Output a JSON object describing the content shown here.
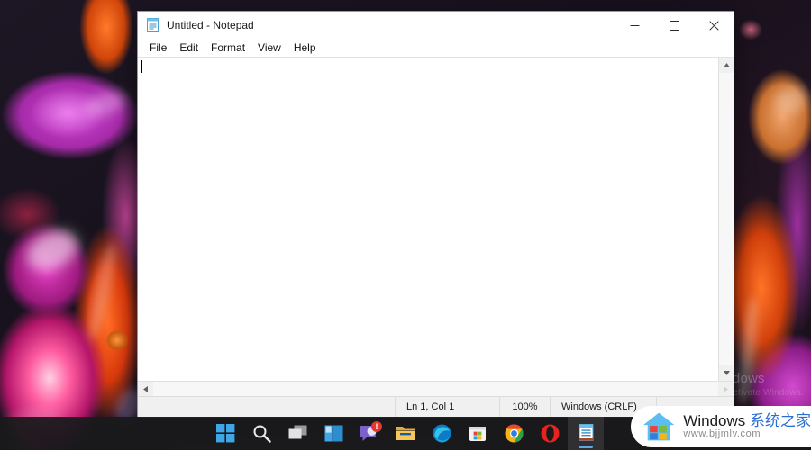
{
  "window": {
    "title": "Untitled - Notepad",
    "icon": "notepad-icon",
    "controls": {
      "minimize": "Minimize",
      "maximize": "Maximize",
      "close": "Close"
    }
  },
  "menubar": {
    "items": [
      {
        "label": "File"
      },
      {
        "label": "Edit"
      },
      {
        "label": "Format"
      },
      {
        "label": "View"
      },
      {
        "label": "Help"
      }
    ]
  },
  "editor": {
    "content": "",
    "caret_visible": true
  },
  "statusbar": {
    "line_col": "Ln 1, Col 1",
    "zoom": "100%",
    "line_ending": "Windows (CRLF)",
    "encoding": ""
  },
  "scrollbars": {
    "vertical_up": "scroll-up-arrow",
    "vertical_down": "scroll-down-arrow",
    "horizontal_left": "scroll-left-arrow",
    "horizontal_right": "scroll-right-arrow"
  },
  "taskbar": {
    "items": [
      {
        "name": "start-button",
        "icon": "windows-logo-icon",
        "label": "Start",
        "active": false,
        "badge": ""
      },
      {
        "name": "search-button",
        "icon": "search-icon",
        "label": "Search",
        "active": false,
        "badge": ""
      },
      {
        "name": "task-view-button",
        "icon": "task-view-icon",
        "label": "Task View",
        "active": false,
        "badge": ""
      },
      {
        "name": "widgets-button",
        "icon": "widgets-icon",
        "label": "Widgets",
        "active": false,
        "badge": ""
      },
      {
        "name": "chat-button",
        "icon": "chat-teams-icon",
        "label": "Chat",
        "active": false,
        "badge": "!"
      },
      {
        "name": "file-explorer-button",
        "icon": "folder-icon",
        "label": "File Explorer",
        "active": false,
        "badge": ""
      },
      {
        "name": "edge-button",
        "icon": "edge-icon",
        "label": "Microsoft Edge",
        "active": false,
        "badge": ""
      },
      {
        "name": "store-button",
        "icon": "microsoft-store-icon",
        "label": "Microsoft Store",
        "active": false,
        "badge": ""
      },
      {
        "name": "chrome-button",
        "icon": "chrome-icon",
        "label": "Google Chrome",
        "active": false,
        "badge": ""
      },
      {
        "name": "opera-button",
        "icon": "opera-icon",
        "label": "Opera",
        "active": false,
        "badge": ""
      },
      {
        "name": "notepad-button",
        "icon": "notepad-icon",
        "label": "Notepad",
        "active": true,
        "badge": ""
      }
    ]
  },
  "desktop": {
    "activation_watermark": {
      "line1": "Activate Windows",
      "line2": "Go to Settings to activate Windows."
    }
  },
  "site_watermark": {
    "brand_en": "Windows ",
    "brand_cn": "系统之家",
    "url": "www.bjjmlv.com",
    "icon": "windows-house-logo-icon"
  },
  "colors": {
    "accent": "#60a5e8",
    "close_hover": "#e81123",
    "badge": "#e03a30",
    "window_bg": "#f0f0f0",
    "editor_bg": "#ffffff",
    "taskbar_bg": "#19191c",
    "watermark_cn": "#2b6fd4"
  }
}
